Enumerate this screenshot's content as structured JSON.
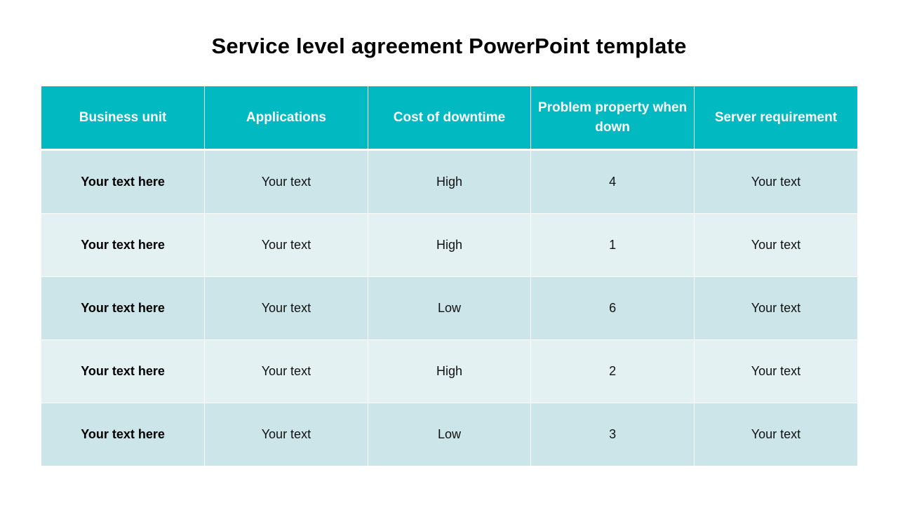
{
  "slide": {
    "title": "Service level agreement PowerPoint template",
    "colors": {
      "header_bg": "#00B9C1",
      "header_text": "#FFFFFF",
      "row_odd_bg": "#CCE5E8",
      "row_even_bg": "#E4F1F2",
      "cell_border": "#FFFFFF"
    }
  },
  "table": {
    "columns": [
      "Business unit",
      "Applications",
      "Cost of downtime",
      "Problem property when down",
      "Server requirement"
    ],
    "rows": [
      [
        "Your text here",
        "Your text",
        "High",
        "4",
        "Your text"
      ],
      [
        "Your text here",
        "Your text",
        "High",
        "1",
        "Your text"
      ],
      [
        "Your text here",
        "Your text",
        "Low",
        "6",
        "Your text"
      ],
      [
        "Your text here",
        "Your text",
        "High",
        "2",
        "Your text"
      ],
      [
        "Your text here",
        "Your text",
        "Low",
        "3",
        "Your text"
      ]
    ]
  }
}
